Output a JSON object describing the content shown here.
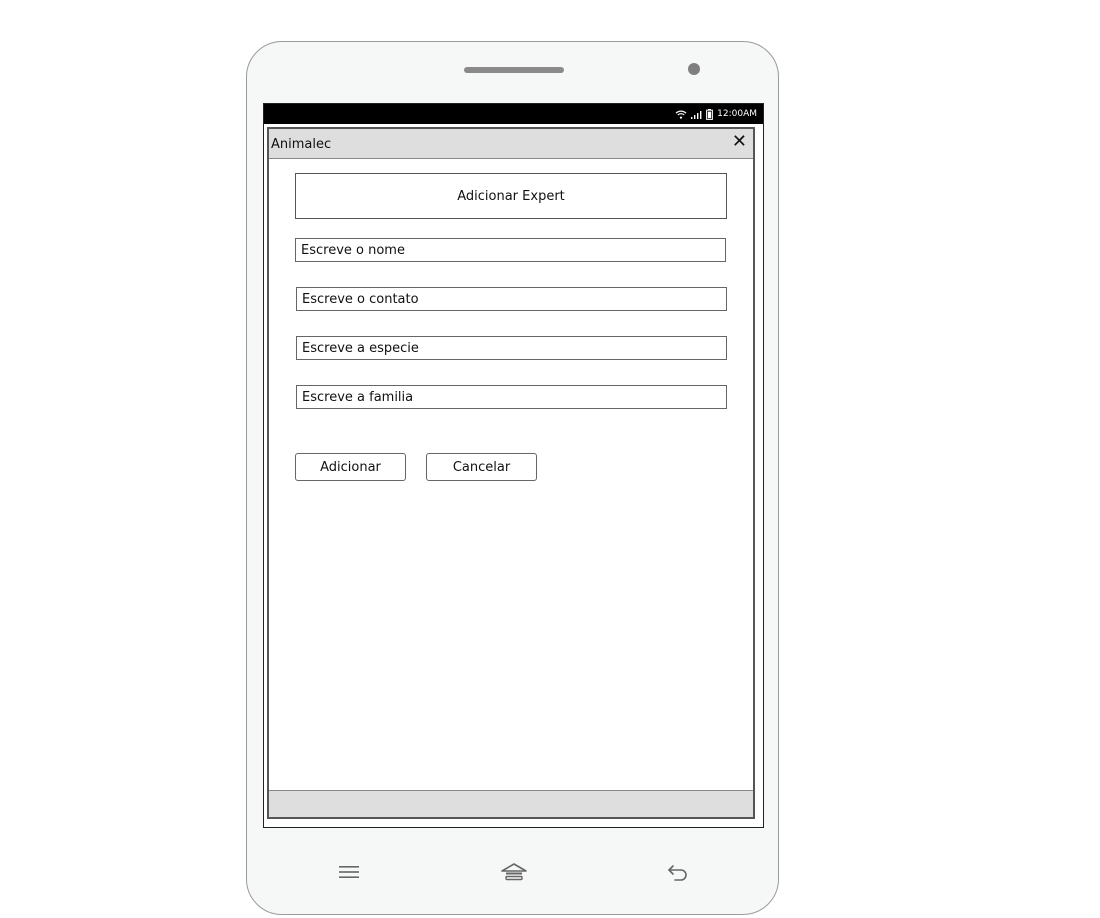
{
  "status_bar": {
    "time": "12:00AM",
    "icons": [
      "wifi-icon",
      "signal-icon",
      "battery-icon"
    ]
  },
  "window": {
    "title": "Animalec",
    "close_symbol": "✕"
  },
  "form": {
    "header": "Adicionar Expert",
    "fields": {
      "name": "Escreve o nome",
      "contact": "Escreve o contato",
      "species": "Escreve a especie",
      "family": "Escreve a familia"
    },
    "buttons": {
      "add": "Adicionar",
      "cancel": "Cancelar"
    }
  },
  "nav_keys": [
    "menu-icon",
    "home-icon",
    "back-icon"
  ]
}
